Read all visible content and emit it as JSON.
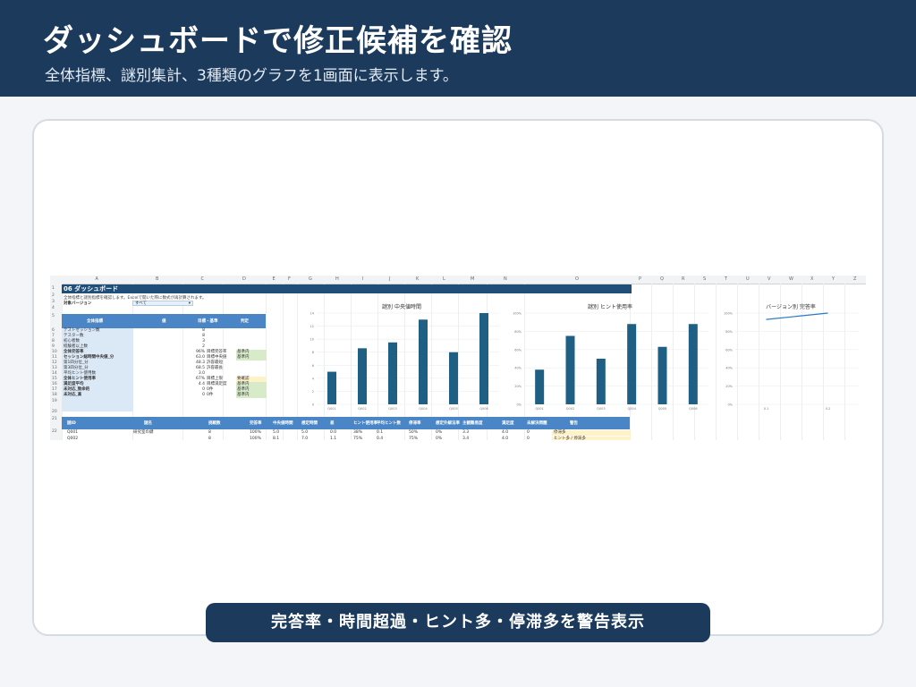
{
  "slide": {
    "title": "ダッシュボードで修正候補を確認",
    "subtitle": "全体指標、謎別集計、3種類のグラフを1画面に表示します。",
    "callout": "完答率・時間超過・ヒント多・停滞多を警告表示"
  },
  "sheet": {
    "columns": [
      "A",
      "B",
      "C",
      "D",
      "E",
      "F",
      "G",
      "H",
      "I",
      "J",
      "K",
      "L",
      "M",
      "N",
      "O",
      "P",
      "Q",
      "R",
      "S",
      "T",
      "U",
      "V",
      "W",
      "X",
      "Y",
      "Z"
    ],
    "rows": [
      "1",
      "2",
      "3",
      "4",
      "5",
      "6",
      "7",
      "8",
      "9",
      "10",
      "11",
      "12",
      "13",
      "14",
      "15",
      "16",
      "17",
      "18",
      "19",
      "20",
      "21",
      "22"
    ],
    "title": "06 ダッシュボード",
    "note": "全体指標と謎別指標を確認します。Excelで開いた際に数式が再計算されます。",
    "version_label": "対象バージョン",
    "version_value": "すべて",
    "kpi_headers": [
      "全体指標",
      "値",
      "目標・基準",
      "判定"
    ],
    "kpis": [
      {
        "label": "テストセッション数",
        "value": "8",
        "target": "",
        "status": "",
        "state": ""
      },
      {
        "label": "テスター数",
        "value": "8",
        "target": "",
        "status": "",
        "state": ""
      },
      {
        "label": "初心者数",
        "value": "3",
        "target": "",
        "status": "",
        "state": ""
      },
      {
        "label": "経験者以上数",
        "value": "2",
        "target": "",
        "status": "",
        "state": ""
      },
      {
        "label": "全体完答率",
        "value": "96%",
        "target": "目標完答率",
        "status": "基準内",
        "state": "ok"
      },
      {
        "label": "セッション総時間中央値_分",
        "value": "63.0",
        "target": "目標中央値",
        "status": "基準内",
        "state": "ok"
      },
      {
        "label": "第1四分位_分",
        "value": "48.3",
        "target": "許容最短",
        "status": "",
        "state": ""
      },
      {
        "label": "第3四分位_分",
        "value": "68.5",
        "target": "許容最長",
        "status": "",
        "state": ""
      },
      {
        "label": "平均ヒント使用数",
        "value": "3.0",
        "target": "",
        "status": "",
        "state": ""
      },
      {
        "label": "全体ヒント使用率",
        "value": "67%",
        "target": "目標上限",
        "status": "要確認",
        "state": "warn"
      },
      {
        "label": "満足度平均",
        "value": "4.4",
        "target": "目標満足度",
        "status": "基準内",
        "state": "ok"
      },
      {
        "label": "未対応_致命的",
        "value": "0",
        "target": "0件",
        "status": "基準内",
        "state": "ok"
      },
      {
        "label": "未対応_高",
        "value": "0",
        "target": "0件",
        "status": "基準内",
        "state": "ok"
      }
    ],
    "detail_headers": [
      "謎ID",
      "謎名",
      "挑戦数",
      "完答率",
      "中央値時間",
      "想定時間",
      "差",
      "ヒント使用率",
      "平均ヒント数",
      "停滞率",
      "想定外解法率",
      "主観難易度",
      "満足度",
      "未解決問題",
      "警告"
    ],
    "detail_rows": [
      [
        "Q001",
        "研究室の鍵",
        "8",
        "100%",
        "5.0",
        "5.0",
        "0.0",
        "38%",
        "0.1",
        "50%",
        "0%",
        "3.3",
        "4.0",
        "0",
        "停滞多"
      ],
      [
        "Q002",
        "",
        "8",
        "100%",
        "8.1",
        "7.0",
        "1.1",
        "75%",
        "0.4",
        "75%",
        "0%",
        "3.4",
        "4.0",
        "0",
        "ヒント多 / 停滞多"
      ]
    ]
  },
  "chart_data": [
    {
      "type": "bar",
      "title": "謎別 中央値時間",
      "categories": [
        "Q001",
        "Q002",
        "Q003",
        "Q004",
        "Q005",
        "Q006"
      ],
      "values": [
        5.0,
        8.6,
        9.5,
        13.0,
        8.0,
        14.0
      ],
      "ylim": [
        0,
        14
      ],
      "yticks": [
        "0",
        "2",
        "4",
        "6",
        "8",
        "10",
        "12",
        "14"
      ],
      "color": "#1f5f84"
    },
    {
      "type": "bar",
      "title": "謎別 ヒント使用率",
      "categories": [
        "Q001",
        "Q002",
        "Q003",
        "Q004",
        "Q005",
        "Q006"
      ],
      "values": [
        38,
        75,
        50,
        88,
        63,
        88
      ],
      "ylim": [
        0,
        100
      ],
      "yticks": [
        "0%",
        "20%",
        "40%",
        "60%",
        "80%",
        "100%"
      ],
      "color": "#1f5f84"
    },
    {
      "type": "line",
      "title": "バージョン別 完答率",
      "categories": [
        "0.1",
        "0.2"
      ],
      "values": [
        93,
        100
      ],
      "ylim": [
        0,
        100
      ],
      "yticks": [
        "0%",
        "20%",
        "40%",
        "60%",
        "80%",
        "100%"
      ],
      "color": "#2b78c2"
    }
  ]
}
